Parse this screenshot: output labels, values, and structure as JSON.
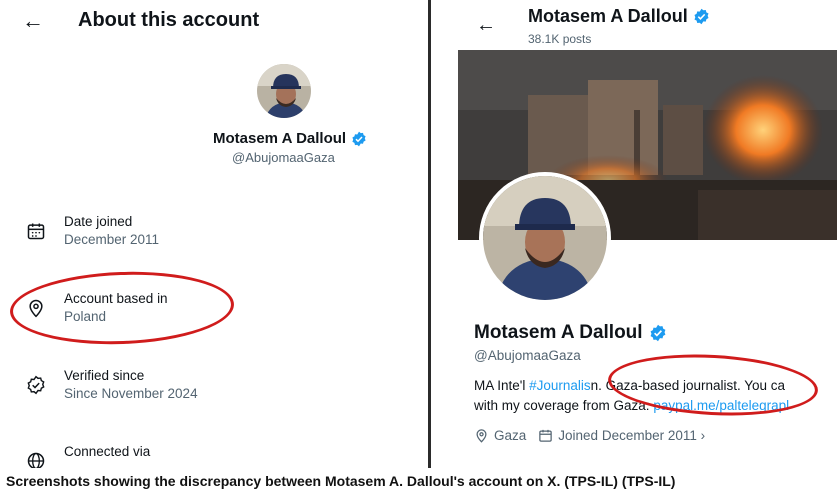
{
  "left": {
    "back_glyph": "←",
    "title": "About this account",
    "name": "Motasem A Dalloul",
    "handle": "@AbujomaaGaza",
    "rows": [
      {
        "icon": "calendar-icon",
        "label": "Date joined",
        "value": "December 2011"
      },
      {
        "icon": "location-pin-icon",
        "label": "Account based in",
        "value": "Poland"
      },
      {
        "icon": "verified-check-icon",
        "label": "Verified since",
        "value": "Since November 2024"
      },
      {
        "icon": "globe-icon",
        "label": "Connected via",
        "value": ""
      }
    ]
  },
  "right": {
    "back_glyph": "←",
    "header_name": "Motasem A Dalloul",
    "posts": "38.1K posts",
    "profile_name": "Motasem A Dalloul",
    "profile_handle": "@AbujomaaGaza",
    "bio_line1_a": "MA Inte'l ",
    "bio_line1_tag": "#Journalis",
    "bio_line1_b": "n. Gaza-based journalist. You ca",
    "bio_line2_a": "with my coverage from Gaza: ",
    "bio_line2_link": "paypal.me/paltelegrapl",
    "location": "Gaza",
    "joined": "Joined December 2011 ›"
  },
  "caption": "Screenshots showing the discrepancy between Motasem A. Dalloul's account on X. (TPS-IL) (TPS-IL)",
  "colors": {
    "verified": "#1d9bf0",
    "annotation": "#d01c1c",
    "link": "#1d9bf0"
  }
}
